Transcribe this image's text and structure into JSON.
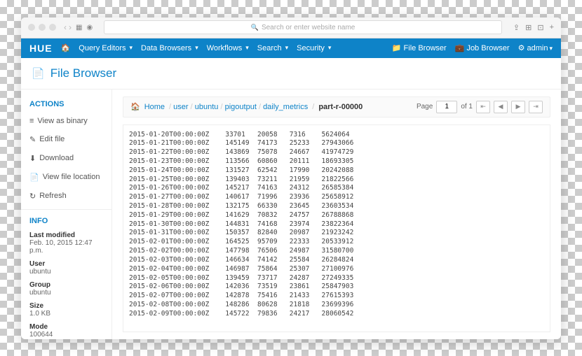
{
  "browser": {
    "url_placeholder": "Search or enter website name"
  },
  "hue": {
    "logo": "HUE",
    "menu": [
      "Query Editors",
      "Data Browsers",
      "Workflows",
      "Search",
      "Security"
    ],
    "right": [
      "File Browser",
      "Job Browser",
      "admin"
    ]
  },
  "header": {
    "title": "File Browser",
    "icon": "📄"
  },
  "sidebar": {
    "actions_title": "ACTIONS",
    "actions": [
      {
        "icon": "≡",
        "label": "View as binary"
      },
      {
        "icon": "✎",
        "label": "Edit file"
      },
      {
        "icon": "⬇",
        "label": "Download"
      },
      {
        "icon": "📄",
        "label": "View file location"
      },
      {
        "icon": "↻",
        "label": "Refresh"
      }
    ],
    "info_title": "INFO",
    "info": [
      {
        "label": "Last modified",
        "value": "Feb. 10, 2015 12:47 p.m."
      },
      {
        "label": "User",
        "value": "ubuntu"
      },
      {
        "label": "Group",
        "value": "ubuntu"
      },
      {
        "label": "Size",
        "value": "1.0 KB"
      },
      {
        "label": "Mode",
        "value": "100644"
      }
    ]
  },
  "breadcrumb": {
    "home": "Home",
    "parts": [
      "user",
      "ubuntu",
      "pigoutput",
      "daily_metrics"
    ],
    "current": "part-r-00000"
  },
  "pager": {
    "label_page": "Page",
    "current": "1",
    "label_of": "of 1"
  },
  "file_rows": [
    [
      "2015-01-20T00:00:00Z",
      "33701",
      "20058",
      "7316",
      "5624064"
    ],
    [
      "2015-01-21T00:00:00Z",
      "145149",
      "74173",
      "25233",
      "27943066"
    ],
    [
      "2015-01-22T00:00:00Z",
      "143869",
      "75078",
      "24667",
      "41974729"
    ],
    [
      "2015-01-23T00:00:00Z",
      "113566",
      "60860",
      "20111",
      "18693305"
    ],
    [
      "2015-01-24T00:00:00Z",
      "131527",
      "62542",
      "17990",
      "20242088"
    ],
    [
      "2015-01-25T00:00:00Z",
      "139403",
      "73211",
      "21959",
      "21822566"
    ],
    [
      "2015-01-26T00:00:00Z",
      "145217",
      "74163",
      "24312",
      "26585384"
    ],
    [
      "2015-01-27T00:00:00Z",
      "140617",
      "71996",
      "23936",
      "25658912"
    ],
    [
      "2015-01-28T00:00:00Z",
      "132175",
      "66330",
      "23645",
      "23603534"
    ],
    [
      "2015-01-29T00:00:00Z",
      "141629",
      "70832",
      "24757",
      "26788868"
    ],
    [
      "2015-01-30T00:00:00Z",
      "144831",
      "74168",
      "23974",
      "23822364"
    ],
    [
      "2015-01-31T00:00:00Z",
      "150357",
      "82840",
      "20987",
      "21923242"
    ],
    [
      "2015-02-01T00:00:00Z",
      "164525",
      "95709",
      "22333",
      "20533912"
    ],
    [
      "2015-02-02T00:00:00Z",
      "147798",
      "76506",
      "24987",
      "31580700"
    ],
    [
      "2015-02-03T00:00:00Z",
      "146634",
      "74142",
      "25584",
      "26284824"
    ],
    [
      "2015-02-04T00:00:00Z",
      "146987",
      "75864",
      "25307",
      "27100976"
    ],
    [
      "2015-02-05T00:00:00Z",
      "139459",
      "73717",
      "24287",
      "27249335"
    ],
    [
      "2015-02-06T00:00:00Z",
      "142036",
      "73519",
      "23861",
      "25847903"
    ],
    [
      "2015-02-07T00:00:00Z",
      "142878",
      "75416",
      "21433",
      "27615393"
    ],
    [
      "2015-02-08T00:00:00Z",
      "148286",
      "80628",
      "21818",
      "23699396"
    ],
    [
      "2015-02-09T00:00:00Z",
      "145722",
      "79836",
      "24217",
      "28060542"
    ]
  ]
}
